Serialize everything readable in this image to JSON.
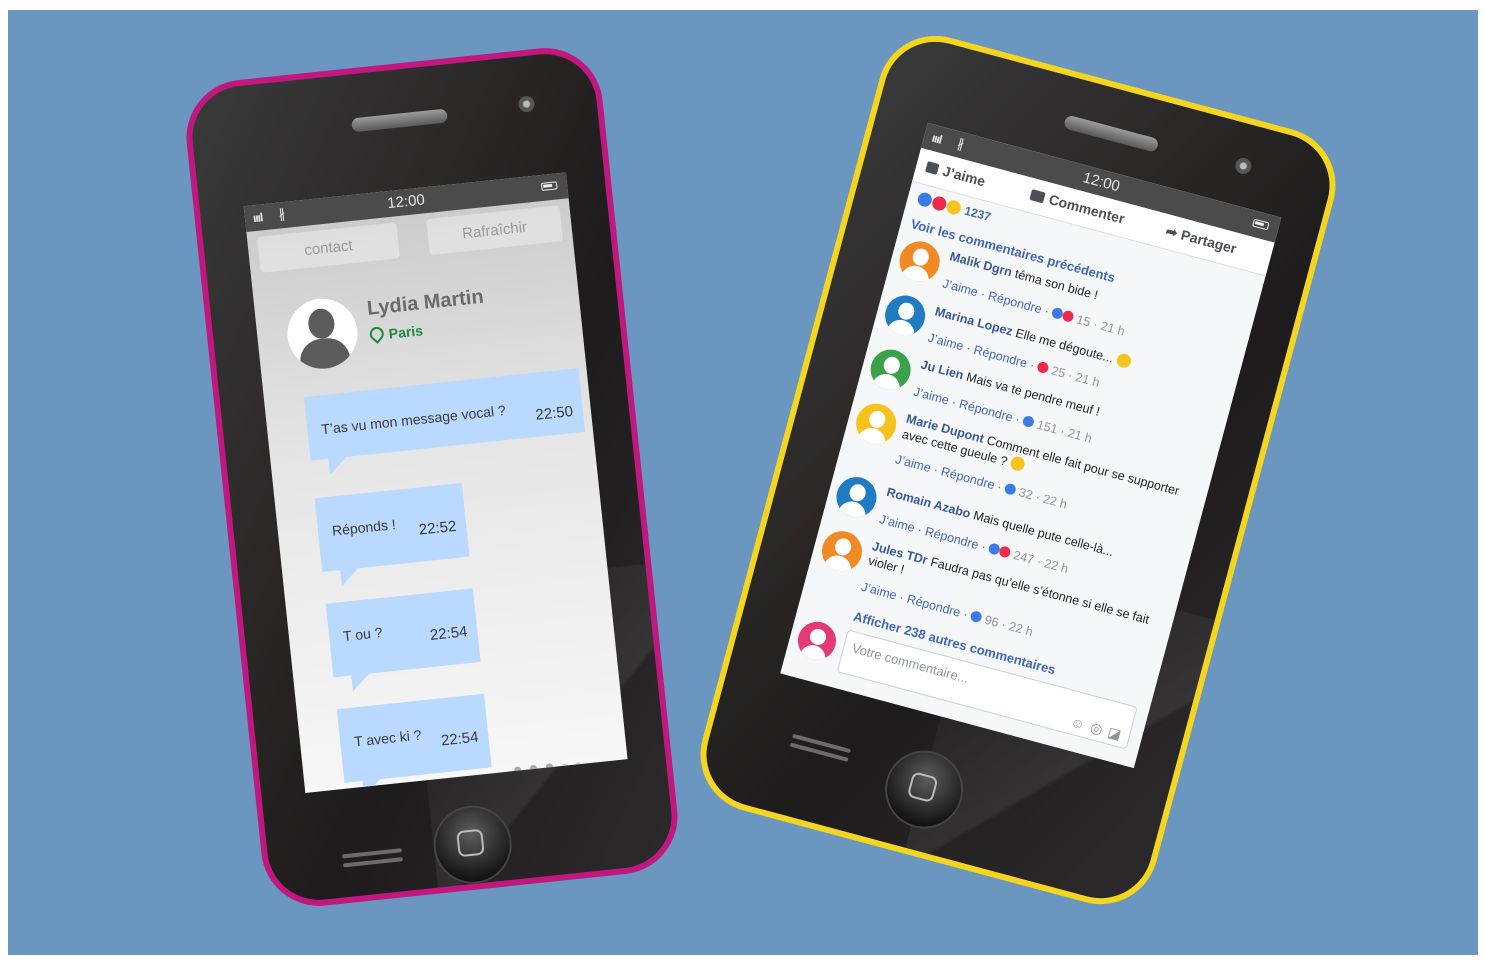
{
  "left_phone": {
    "status": {
      "time": "12:00",
      "signal": "ıııl",
      "bluetooth": "∦"
    },
    "nav": {
      "back_label": "contact",
      "refresh_label": "Rafraîchir"
    },
    "contact": {
      "name": "Lydia Martin",
      "location": "Paris"
    },
    "messages": [
      {
        "text": "T’as vu mon message vocal ?",
        "time": "22:50"
      },
      {
        "text": "Réponds !",
        "time": "22:52"
      },
      {
        "text": "T ou ?",
        "time": "22:54"
      },
      {
        "text": "T avec ki ?",
        "time": "22:54"
      }
    ]
  },
  "right_phone": {
    "status": {
      "time": "12:00",
      "signal": "ıııl",
      "bluetooth": "∦"
    },
    "actions": {
      "like": "J’aime",
      "comment": "Commenter",
      "share": "Partager"
    },
    "reaction_count": "1237",
    "previous_link": "Voir les commentaires précédents",
    "comment_like_label": "J’aime",
    "comment_reply_label": "Répondre",
    "comments": [
      {
        "name": "Malik Dgrn",
        "text": "téma son bide !",
        "count": "15",
        "age": "21 h",
        "avatar_color": "#f08a24"
      },
      {
        "name": "Marina Lopez",
        "text": "Elle me dégoute...",
        "count": "25",
        "age": "21 h",
        "avatar_color": "#1e7bc4"
      },
      {
        "name": "Ju Lien",
        "text": "Mais va te pendre meuf !",
        "count": "151",
        "age": "21 h",
        "avatar_color": "#3aa34a"
      },
      {
        "name": "Marie Dupont",
        "text": "Comment elle fait pour se supporter avec cette gueule ?",
        "count": "32",
        "age": "22 h",
        "avatar_color": "#f7c21b"
      },
      {
        "name": "Romain Azabo",
        "text": "Mais quelle pute celle-là...",
        "count": "247",
        "age": "22 h",
        "avatar_color": "#1e7bc4"
      },
      {
        "name": "Jules TDr",
        "text": "Faudra pas qu’elle s’étonne si elle se fait violer !",
        "count": "96",
        "age": "22 h",
        "avatar_color": "#f08a24"
      }
    ],
    "more_link": "Afficher 238 autres commentaires",
    "input_placeholder": "Votre commentaire...",
    "input_icons": [
      "emoji-icon",
      "camera-icon",
      "sticker-icon"
    ]
  },
  "colors": {
    "background": "#6a96c0",
    "left_frame": "#c0187f",
    "right_frame": "#f4d51f",
    "bubble": "#b9d9ff",
    "facebook_blue": "#4267b2"
  }
}
